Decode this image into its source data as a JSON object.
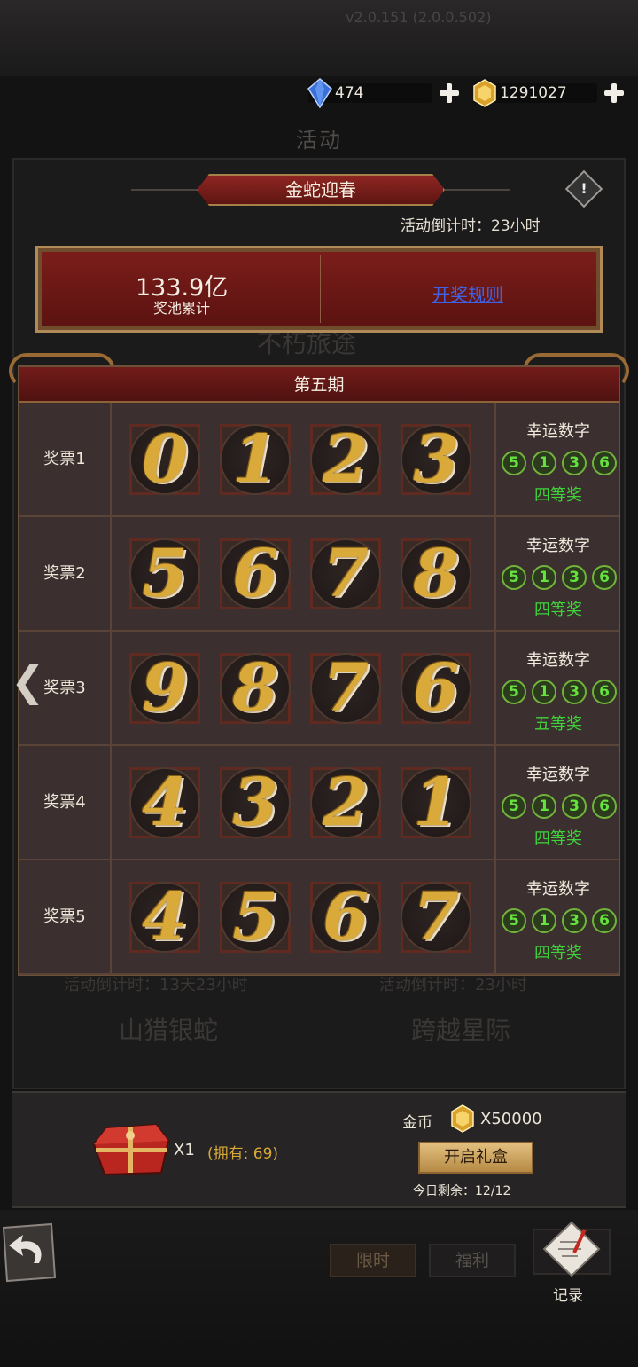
{
  "status_line": "v2.0.151 (2.0.0.502)",
  "currency": {
    "diamond": {
      "icon": "blue-diamond-icon",
      "value": "474"
    },
    "gold": {
      "icon": "gold-gem-icon",
      "value": "1291027"
    }
  },
  "page_title": "活动",
  "event": {
    "banner_title": "金蛇迎春",
    "countdown": "活动倒计时：23小时",
    "pool_amount": "133.9亿",
    "pool_label": "奖池累计",
    "rules_link": "开奖规则"
  },
  "ghost_text": {
    "behind_pool": "不朽旅途",
    "behind_table_left": "活动倒计时：13天23小时",
    "behind_table_right": "活动倒计时：23小时",
    "tab_left": "山猎银蛇",
    "tab_right": "跨越星际"
  },
  "draw": {
    "period_title": "第五期",
    "lucky_title": "幸运数字",
    "lucky_numbers": [
      "5",
      "1",
      "3",
      "6"
    ],
    "tickets": [
      {
        "label": "奖票1",
        "digits": [
          "0",
          "1",
          "2",
          "3"
        ],
        "prize": "四等奖"
      },
      {
        "label": "奖票2",
        "digits": [
          "5",
          "6",
          "7",
          "8"
        ],
        "prize": "四等奖"
      },
      {
        "label": "奖票3",
        "digits": [
          "9",
          "8",
          "7",
          "6"
        ],
        "prize": "五等奖"
      },
      {
        "label": "奖票4",
        "digits": [
          "4",
          "3",
          "2",
          "1"
        ],
        "prize": "四等奖"
      },
      {
        "label": "奖票5",
        "digits": [
          "4",
          "5",
          "6",
          "7"
        ],
        "prize": "四等奖"
      }
    ]
  },
  "gift": {
    "quantity": "X1",
    "owned": "(拥有: 69)",
    "coin_label": "金币",
    "coin_amount": "X50000",
    "open_button": "开启礼盒",
    "remaining": "今日剩余：12/12"
  },
  "nav": {
    "tab_limited": "限时",
    "tab_welfare": "福利",
    "record": "记录"
  },
  "colors": {
    "accent_gold": "#d9a93a",
    "banner_red": "#7c1e1b",
    "lucky_green": "#66e23e",
    "link_blue": "#3f63e6"
  }
}
